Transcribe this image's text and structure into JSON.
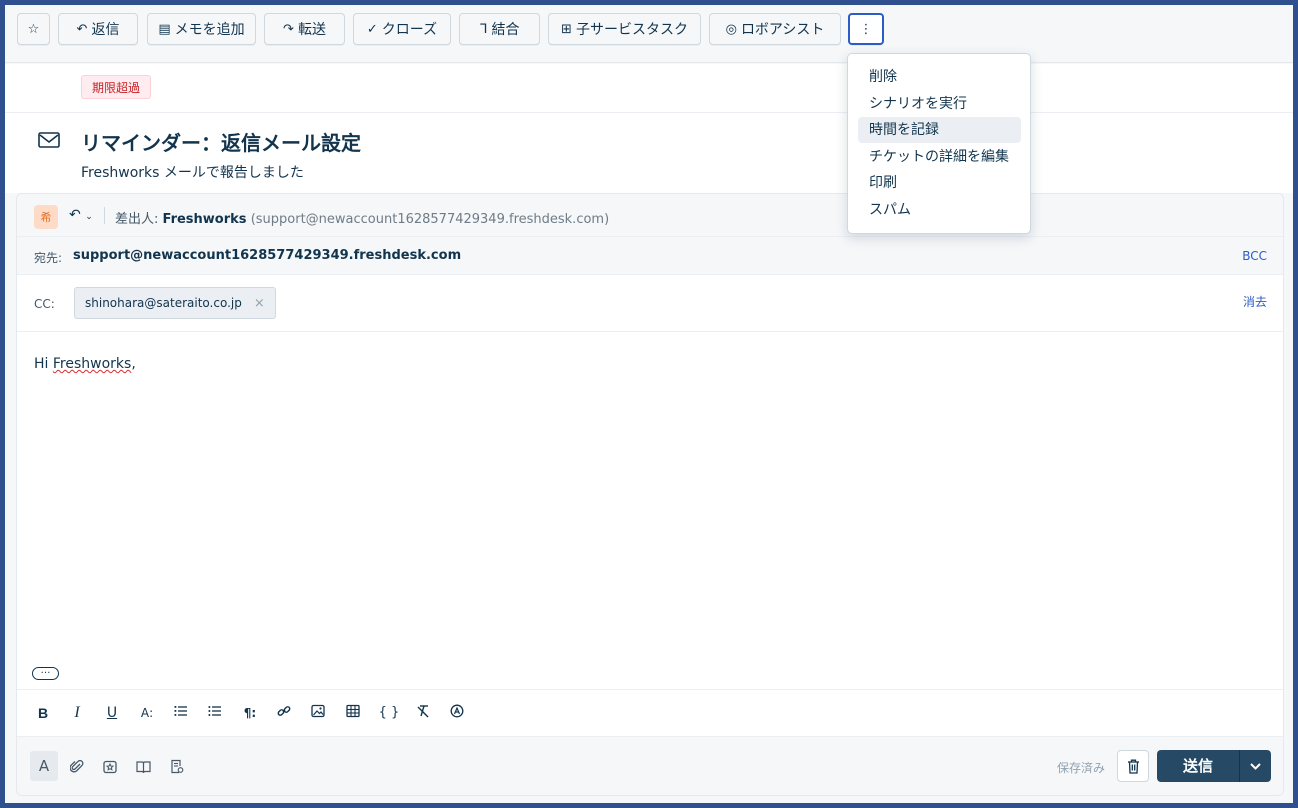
{
  "toolbar": {
    "star_label": "☆",
    "reply_label": "返信",
    "add_note_label": "メモを追加",
    "forward_label": "転送",
    "close_label": "クローズ",
    "merge_label": "結合",
    "child_task_label": "子サービスタスク",
    "robo_assist_label": "ロボアシスト",
    "more_label": "⋮"
  },
  "dropdown": {
    "items": [
      "削除",
      "シナリオを実行",
      "時間を記録",
      "チケットの詳細を編集",
      "印刷",
      "スパム"
    ],
    "highlighted_index": 2
  },
  "badge": {
    "overdue": "期限超過"
  },
  "ticket": {
    "title": "リマインダー：返信メール設定",
    "source_name": "Freshworks",
    "source_suffix": " メールで報告しました"
  },
  "reply": {
    "avatar_text": "希",
    "from_label": "差出人:",
    "from_name": "Freshworks",
    "from_email": "(support@newaccount1628577429349.freshdesk.com)",
    "to_label": "宛先:",
    "to_value": "support@newaccount1628577429349.freshdesk.com",
    "bcc_label": "BCC",
    "cc_label": "CC:",
    "cc_chip": "shinohara@sateraito.co.jp",
    "cc_chip_remove": "×",
    "clear_label": "消去",
    "body_greeting_prefix": "Hi ",
    "body_greeting_name": "Freshworks",
    "body_greeting_suffix": ",",
    "ellipsis": "…",
    "saved_label": "保存済み",
    "send_label": "送信"
  },
  "format_toolbar": {
    "bold": "B",
    "italic": "I",
    "underline": "U",
    "font_size": "A꞉",
    "paragraph": "¶꞉",
    "code": "{ }"
  }
}
